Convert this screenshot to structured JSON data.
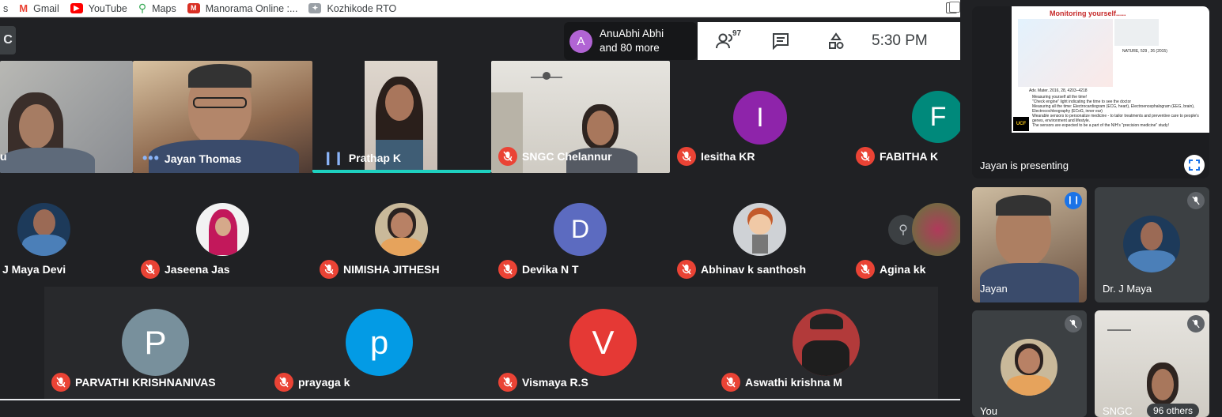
{
  "bookmarks": [
    {
      "label": "s",
      "icon": "bookmark-icon",
      "color": "#5f6368"
    },
    {
      "label": "Gmail",
      "icon": "gmail-icon",
      "color": "#ea4335"
    },
    {
      "label": "YouTube",
      "icon": "youtube-icon",
      "color": "#ff0000"
    },
    {
      "label": "Maps",
      "icon": "maps-icon",
      "color": "#34a853"
    },
    {
      "label": "Manorama Online :...",
      "icon": "manorama-icon",
      "color": "#d93025"
    },
    {
      "label": "Kozhikode RTO",
      "icon": "rto-icon",
      "color": "#5f6368"
    }
  ],
  "meeting": {
    "left_badge": "C",
    "raised_hand_avatar": "A",
    "raised_hand_name": "AnuAbhi Abhi",
    "raised_hand_more": "and 80 more",
    "participant_count": "97",
    "time": "5:30  PM"
  },
  "grid_row1": [
    {
      "name": "u",
      "mic": "none"
    },
    {
      "name": "Jayan Thomas",
      "mic": "dots"
    },
    {
      "name": "Prathap K",
      "mic": "speaking"
    },
    {
      "name": "SNGC Chelannur",
      "mic": "muted"
    },
    {
      "name": "Iesitha KR",
      "mic": "muted",
      "letter": "I",
      "color": "#8e24aa"
    },
    {
      "name": "FABITHA K",
      "mic": "muted",
      "letter": "F",
      "color": "#00897b"
    }
  ],
  "grid_row2": [
    {
      "name": "J Maya Devi"
    },
    {
      "name": "Jaseena Jas"
    },
    {
      "name": "NIMISHA JITHESH"
    },
    {
      "name": "Devika N T",
      "letter": "D",
      "color": "#5c6bc0"
    },
    {
      "name": "Abhinav k santhosh"
    },
    {
      "name": "Agina kk"
    }
  ],
  "grid_row3": [
    {
      "name": "PARVATHI KRISHNANIVAS",
      "letter": "P",
      "color": "#78909c"
    },
    {
      "name": "prayaga k",
      "letter": "p",
      "color": "#039be5"
    },
    {
      "name": "Vismaya R.S",
      "letter": "V",
      "color": "#e53935"
    },
    {
      "name": "Aswathi krishna M"
    }
  ],
  "presentation": {
    "slide_title": "Monitoring yourself.....",
    "slide_bullets": [
      "Measuring yourself all the time!",
      "\"Check engine\" light indicating the time to see the doctor",
      "Measuring all the time: Electrocardiogram (ECG, heart), Electroencephalogram (EEG, brain), Electrocochleography (ECoG, inner ear)",
      "Wearable sensors to personalize medicine - to tailor treatments and preventive care to people's genes, environment and lifestyle.",
      "The sensors are expected to be a part of the NIH's \"precision medicine\" study!"
    ],
    "slide_logo": "UCF",
    "slide_ref1": "NATURE, 529 , 26 (2015)",
    "slide_ref2": "Adv. Mater. 2016, 28, 4203–4218",
    "presenting_label": "Jayan is presenting"
  },
  "side_tiles": [
    {
      "name": "Jayan"
    },
    {
      "name": "Dr. J Maya"
    },
    {
      "name": "You"
    },
    {
      "name": "SNGC"
    }
  ],
  "others_label": "96 others"
}
